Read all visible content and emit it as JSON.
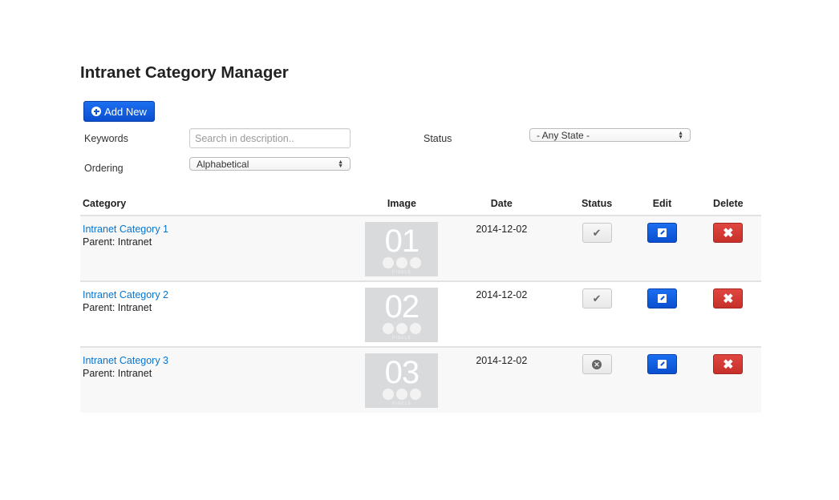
{
  "page": {
    "title": "Intranet Category Manager"
  },
  "toolbar": {
    "add_label": "Add New"
  },
  "filters": {
    "keywords_label": "Keywords",
    "keywords_value": "",
    "keywords_placeholder": "Search in description..",
    "ordering_label": "Ordering",
    "ordering_value": "Alphabetical",
    "status_label": "Status",
    "status_value": "- Any State -"
  },
  "table": {
    "headers": {
      "category": "Category",
      "image": "Image",
      "date": "Date",
      "status": "Status",
      "edit": "Edit",
      "delete": "Delete"
    },
    "rows": [
      {
        "name": "Intranet Category 1",
        "parent": "Parent: Intranet",
        "image_number": "01",
        "image_caption": "PIXELS",
        "date": "2014-12-02",
        "status": "published",
        "status_icon": "✔"
      },
      {
        "name": "Intranet Category 2",
        "parent": "Parent: Intranet",
        "image_number": "02",
        "image_caption": "PIXELS",
        "date": "2014-12-02",
        "status": "published",
        "status_icon": "✔"
      },
      {
        "name": "Intranet Category 3",
        "parent": "Parent: Intranet",
        "image_number": "03",
        "image_caption": "PIXELS",
        "date": "2014-12-02",
        "status": "unpublished",
        "status_icon": "✕"
      }
    ],
    "delete_icon": "✖"
  },
  "colors": {
    "primary": "#0b57d8",
    "danger": "#d23a33",
    "link": "#0a74cc"
  }
}
